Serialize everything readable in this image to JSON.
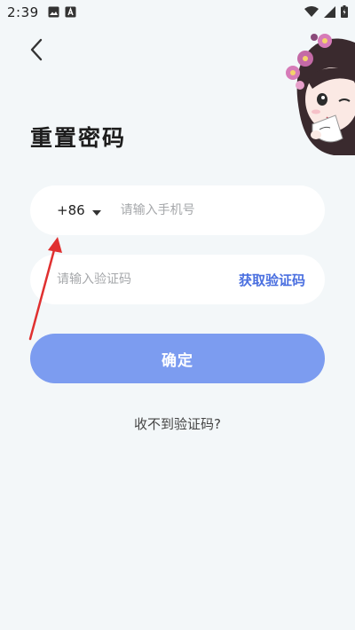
{
  "status_bar": {
    "time": "2:39",
    "left_icons": [
      "image-icon",
      "a-notification-icon"
    ],
    "right_icons": [
      "wifi-icon",
      "signal-icon",
      "battery-icon"
    ]
  },
  "header": {
    "back_icon": "chevron-left-icon",
    "title": "重置密码"
  },
  "phone_field": {
    "country_code": "+86",
    "placeholder": "请输入手机号",
    "value": ""
  },
  "code_field": {
    "placeholder": "请输入验证码",
    "value": "",
    "get_code_label": "获取验证码"
  },
  "confirm_button": {
    "label": "确定"
  },
  "no_code_link": {
    "label": "收不到验证码?"
  },
  "colors": {
    "background": "#f3f7f9",
    "accent": "#4a6fe0",
    "button": "#7c9cf0",
    "annotation": "#e03030"
  }
}
